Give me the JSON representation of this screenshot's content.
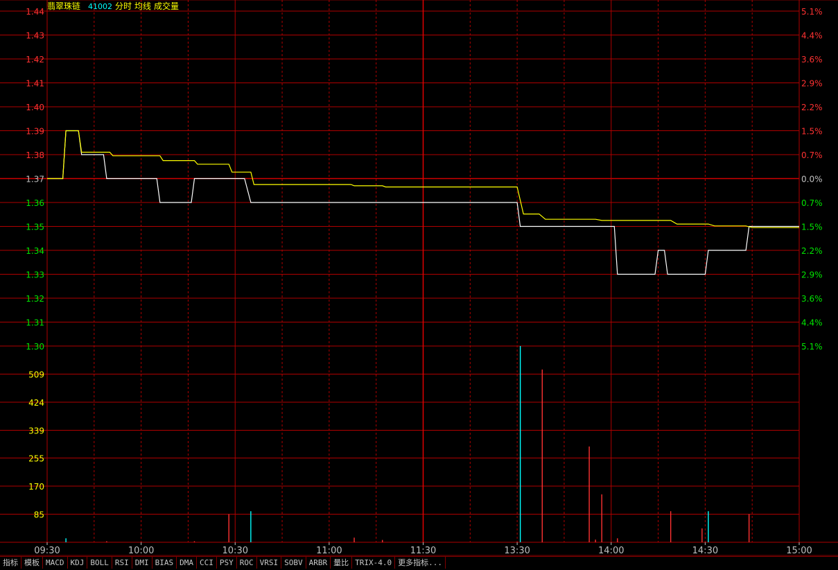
{
  "header": {
    "name": "翡翠珠链",
    "code": "41002",
    "mode": "分时",
    "avg_label": "均线",
    "vol_label": "成交量"
  },
  "chart_data": {
    "type": "line",
    "price_axis": {
      "ticks": [
        "1.44",
        "1.43",
        "1.42",
        "1.41",
        "1.40",
        "1.39",
        "1.38",
        "1.37",
        "1.36",
        "1.35",
        "1.34",
        "1.33",
        "1.32",
        "1.31",
        "1.30"
      ],
      "ylim": [
        1.3,
        1.44
      ],
      "base": 1.37
    },
    "pct_axis": {
      "ticks": [
        "5.1%",
        "4.4%",
        "3.6%",
        "2.9%",
        "2.2%",
        "1.5%",
        "0.7%",
        "0.0%",
        "0.7%",
        "1.5%",
        "2.2%",
        "2.9%",
        "3.6%",
        "4.4%",
        "5.1%"
      ]
    },
    "volume_axis": {
      "ticks": [
        "509",
        "424",
        "339",
        "255",
        "170",
        "85"
      ],
      "ylim": [
        0,
        594
      ]
    },
    "x_ticks": [
      "09:30",
      "10:00",
      "10:30",
      "11:00",
      "11:30",
      "13:30",
      "14:00",
      "14:30",
      "15:00"
    ],
    "series": [
      {
        "key": "price",
        "color": "#ffffff",
        "points": [
          [
            0,
            1.37
          ],
          [
            5,
            1.37
          ],
          [
            6,
            1.39
          ],
          [
            10,
            1.39
          ],
          [
            11,
            1.38
          ],
          [
            18,
            1.38
          ],
          [
            19,
            1.37
          ],
          [
            35,
            1.37
          ],
          [
            36,
            1.36
          ],
          [
            46,
            1.36
          ],
          [
            47,
            1.37
          ],
          [
            63,
            1.37
          ],
          [
            65,
            1.36
          ],
          [
            120,
            1.36
          ],
          [
            150,
            1.36
          ],
          [
            151,
            1.35
          ],
          [
            181,
            1.35
          ],
          [
            182,
            1.33
          ],
          [
            194,
            1.33
          ],
          [
            195,
            1.34
          ],
          [
            197,
            1.34
          ],
          [
            198,
            1.33
          ],
          [
            210,
            1.33
          ],
          [
            211,
            1.34
          ],
          [
            223,
            1.34
          ],
          [
            224,
            1.35
          ],
          [
            240,
            1.35
          ]
        ]
      },
      {
        "key": "average",
        "color": "#ffff00",
        "points": [
          [
            0,
            1.37
          ],
          [
            5,
            1.37
          ],
          [
            6,
            1.39
          ],
          [
            10,
            1.39
          ],
          [
            11,
            1.381
          ],
          [
            20,
            1.381
          ],
          [
            21,
            1.3795
          ],
          [
            36,
            1.3795
          ],
          [
            37,
            1.3775
          ],
          [
            47,
            1.3775
          ],
          [
            48,
            1.376
          ],
          [
            58,
            1.376
          ],
          [
            59,
            1.3727
          ],
          [
            65,
            1.3727
          ],
          [
            66,
            1.3675
          ],
          [
            97,
            1.3675
          ],
          [
            98,
            1.367
          ],
          [
            107,
            1.367
          ],
          [
            108,
            1.3665
          ],
          [
            120,
            1.3665
          ],
          [
            150,
            1.3665
          ],
          [
            152,
            1.3552
          ],
          [
            157,
            1.3552
          ],
          [
            159,
            1.353
          ],
          [
            175,
            1.353
          ],
          [
            177,
            1.3525
          ],
          [
            199,
            1.3525
          ],
          [
            201,
            1.351
          ],
          [
            211,
            1.351
          ],
          [
            213,
            1.3502
          ],
          [
            223,
            1.3502
          ],
          [
            225,
            1.3495
          ],
          [
            240,
            1.3495
          ]
        ]
      }
    ],
    "volume": [
      {
        "t": 6,
        "v": 12,
        "c": "cyan"
      },
      {
        "t": 19,
        "v": 3,
        "c": "red"
      },
      {
        "t": 47,
        "v": 3,
        "c": "red"
      },
      {
        "t": 58,
        "v": 85,
        "c": "red"
      },
      {
        "t": 65,
        "v": 94,
        "c": "cyan"
      },
      {
        "t": 98,
        "v": 14,
        "c": "red"
      },
      {
        "t": 107,
        "v": 7,
        "c": "red"
      },
      {
        "t": 151,
        "v": 594,
        "c": "cyan"
      },
      {
        "t": 158,
        "v": 523,
        "c": "red"
      },
      {
        "t": 173,
        "v": 290,
        "c": "red"
      },
      {
        "t": 175,
        "v": 8,
        "c": "red"
      },
      {
        "t": 177,
        "v": 145,
        "c": "red"
      },
      {
        "t": 182,
        "v": 12,
        "c": "red"
      },
      {
        "t": 199,
        "v": 94,
        "c": "red"
      },
      {
        "t": 209,
        "v": 42,
        "c": "red"
      },
      {
        "t": 211,
        "v": 94,
        "c": "cyan"
      },
      {
        "t": 224,
        "v": 85,
        "c": "red"
      }
    ]
  },
  "indicator_tabs": [
    "指标",
    "模板",
    "MACD",
    "KDJ",
    "BOLL",
    "RSI",
    "DMI",
    "BIAS",
    "DMA",
    "CCI",
    "PSY",
    "ROC",
    "VRSI",
    "SOBV",
    "ARBR",
    "量比",
    "TRIX-4.0",
    "更多指标..."
  ]
}
